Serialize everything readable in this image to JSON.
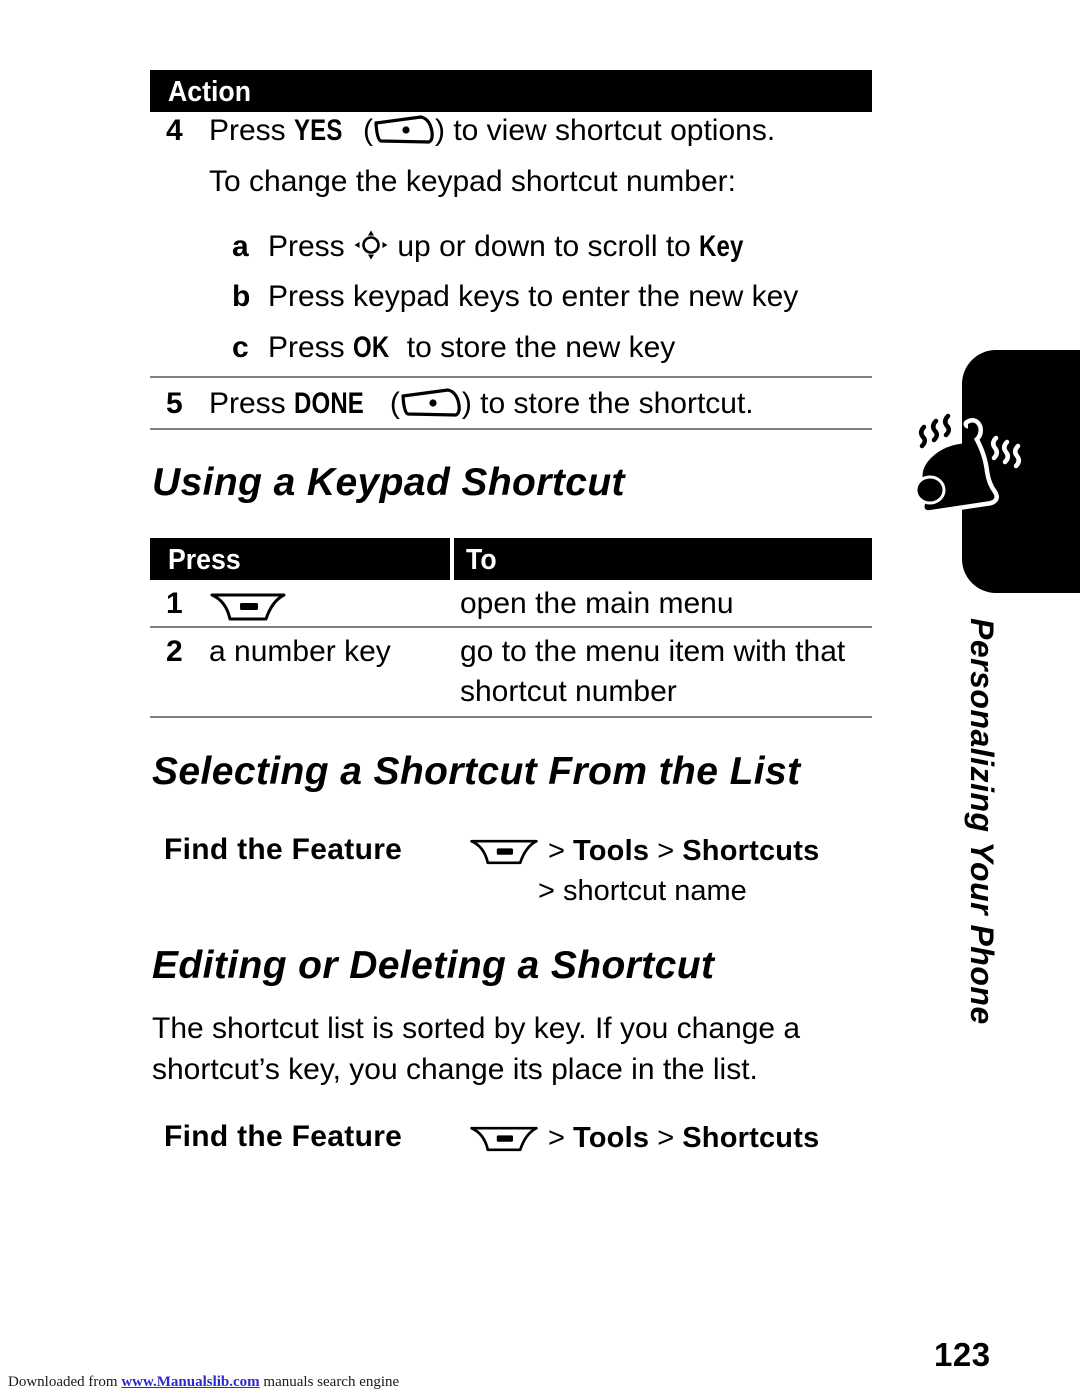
{
  "page": {
    "number": "123",
    "side_tab_label": "Personalizing Your Phone",
    "side_tab_icon": "ringing-bell-icon"
  },
  "action_table": {
    "header": "Action",
    "rows": [
      {
        "num": "4",
        "pre": "Press ",
        "key_label": "YES",
        "key_icon": "soft-key-icon",
        "post": ") to view shortcut options."
      },
      {
        "num": "",
        "text": "To change the keypad shortcut number:"
      },
      {
        "num": "a",
        "pre": "Press ",
        "icon": "nav-key-icon",
        "post": " up or down to scroll to ",
        "bold_tail": "Key"
      },
      {
        "num": "b",
        "text": "Press keypad keys to enter the new key"
      },
      {
        "num": "c",
        "pre": "Press ",
        "bold_mid": "OK",
        "post": " to store the new key"
      },
      {
        "num": "5",
        "pre": "Press ",
        "key_label": "DONE",
        "key_icon": "soft-key-icon",
        "post": ") to store the shortcut."
      }
    ]
  },
  "sections": [
    {
      "heading": "Using a Keypad Shortcut",
      "table": {
        "headers": [
          "Press",
          "To"
        ],
        "rows": [
          {
            "num": "1",
            "press_icon": "menu-key-icon",
            "press": "",
            "to": "open the main menu"
          },
          {
            "num": "2",
            "press_icon": "",
            "press": "a number key",
            "to_line1": "go to the menu item with that",
            "to_line2": "shortcut number"
          }
        ]
      }
    },
    {
      "heading": "Selecting a Shortcut From the List",
      "find_feature": {
        "label": "Find the Feature",
        "icon": "menu-key-icon",
        "path_line1": "> Tools > Shortcuts",
        "path_line1_parts": [
          "> ",
          "Tools",
          " > ",
          "Shortcuts"
        ],
        "path_line2": "> shortcut name"
      }
    },
    {
      "heading": "Editing or Deleting a Shortcut",
      "paragraph": "The shortcut list is sorted by key. If you change a shortcut’s key, you change its place in the list.",
      "find_feature": {
        "label": "Find the Feature",
        "icon": "menu-key-icon",
        "path_line1": "> Tools > Shortcuts",
        "path_line1_parts": [
          "> ",
          "Tools",
          " > ",
          "Shortcuts"
        ]
      }
    }
  ],
  "footer": {
    "prefix": "Downloaded from ",
    "link": "www.Manualslib.com",
    "suffix": " manuals search engine"
  }
}
